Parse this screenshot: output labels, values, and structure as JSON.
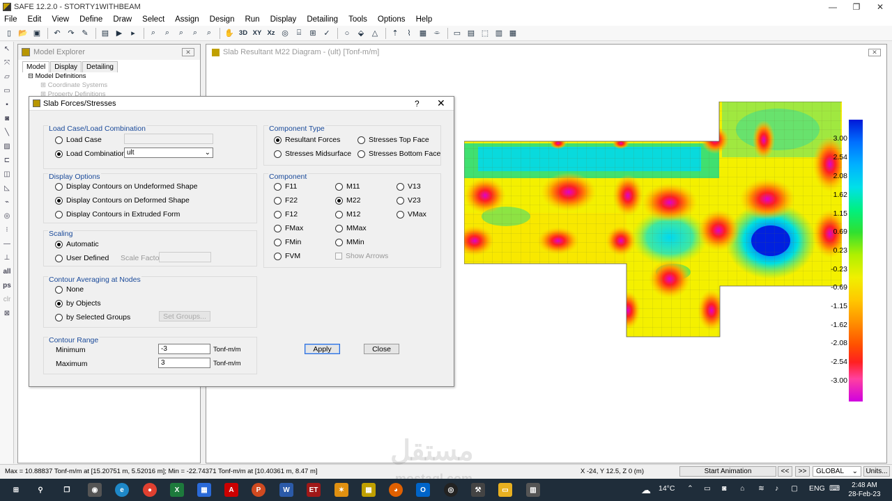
{
  "window": {
    "title": "SAFE 12.2.0 - STORTY1WITHBEAM"
  },
  "menu": [
    "File",
    "Edit",
    "View",
    "Define",
    "Draw",
    "Select",
    "Assign",
    "Design",
    "Run",
    "Display",
    "Detailing",
    "Tools",
    "Options",
    "Help"
  ],
  "toolbar": {
    "btn_3d": "3D",
    "btn_xy": "XY",
    "btn_xz": "Xz"
  },
  "explorer": {
    "title": "Model Explorer",
    "tabs": [
      "Model",
      "Display",
      "Detailing"
    ],
    "tree": [
      "Model Definitions",
      "Coordinate Systems",
      "Property Definitions"
    ]
  },
  "viewport": {
    "title": "Slab Resultant M22 Diagram - (ult)  [Tonf-m/m]"
  },
  "legend": {
    "labels": [
      "3.00",
      "2.54",
      "2.08",
      "1.62",
      "1.15",
      "0.69",
      "0.23",
      "-0.23",
      "-0.69",
      "-1.15",
      "-1.62",
      "-2.08",
      "-2.54",
      "-3.00"
    ]
  },
  "dialog": {
    "title": "Slab Forces/Stresses",
    "help": "?",
    "load": {
      "title": "Load Case/Load Combination",
      "load_case": "Load Case",
      "load_combination": "Load Combination",
      "combo_value": "ult",
      "selected": "Load Combination"
    },
    "display_options": {
      "title": "Display Options",
      "opt1": "Display Contours on Undeformed Shape",
      "opt2": "Display Contours on Deformed Shape",
      "opt3": "Display Contours in Extruded Form",
      "selected": "Display Contours on Deformed Shape"
    },
    "scaling": {
      "title": "Scaling",
      "automatic": "Automatic",
      "user_defined": "User Defined",
      "scale_factor": "Scale Factor",
      "selected": "Automatic"
    },
    "averaging": {
      "title": "Contour Averaging at Nodes",
      "none": "None",
      "by_objects": "by Objects",
      "by_groups": "by Selected Groups",
      "set_groups": "Set Groups...",
      "selected": "by Objects"
    },
    "range": {
      "title": "Contour Range",
      "min_label": "Minimum",
      "min_value": "-3",
      "max_label": "Maximum",
      "max_value": "3",
      "unit": "Tonf-m/m"
    },
    "component_type": {
      "title": "Component Type",
      "resultant": "Resultant Forces",
      "top": "Stresses Top Face",
      "mid": "Stresses Midsurface",
      "bottom": "Stresses Bottom Face",
      "selected": "Resultant Forces"
    },
    "component": {
      "title": "Component",
      "c1": [
        "F11",
        "F22",
        "F12",
        "FMax",
        "FMin",
        "FVM"
      ],
      "c2": [
        "M11",
        "M22",
        "M12",
        "MMax",
        "MMin"
      ],
      "c3": [
        "V13",
        "V23",
        "VMax"
      ],
      "show_arrows": "Show Arrows",
      "selected": "M22"
    },
    "apply": "Apply",
    "close": "Close"
  },
  "status": {
    "left": "Max = 10.88837 Tonf-m/m at [15.20751 m, 5.52016 m];  Min = -22.74371 Tonf-m/m at [10.40361 m, 8.47 m]",
    "coords": "X -24,  Y 12.5,  Z 0   (m)",
    "animation": "Start Animation",
    "prev": "<<",
    "next": ">>",
    "coordsys": "GLOBAL",
    "units": "Units..."
  },
  "taskbar": {
    "weather": "14°C",
    "lang": "ENG",
    "time": "2:48 AM",
    "date": "28-Feb-23"
  },
  "watermark": {
    "text": "مستقل",
    "sub": "mostaql.com"
  }
}
